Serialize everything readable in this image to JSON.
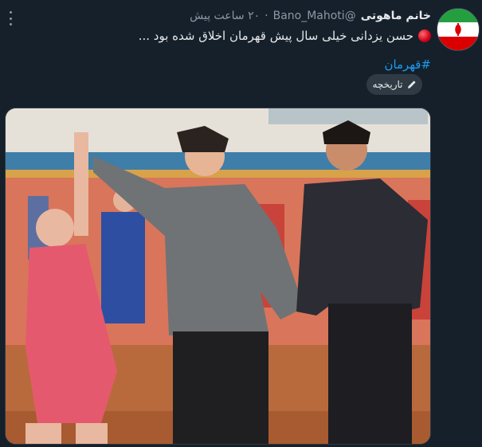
{
  "tweet": {
    "author_name": "خانم ماهوتی",
    "author_handle": "@Bano_Mahoti",
    "separator": "·",
    "timestamp": "۲۰ ساعت پیش",
    "text": "حسن یزدانی خیلی سال پیش قهرمان اخلاق شده بود ...",
    "hashtag": "#قهرمان",
    "history_label": "تاریخچه",
    "avatar_icon": "iran-emblem-avatar",
    "photo_icon": "wrestling-photo"
  },
  "colors": {
    "background": "#15202b",
    "text": "#e7e9ea",
    "muted": "#8b98a5",
    "link": "#1d9bf0",
    "button_bg": "#2f3a45",
    "red_emoji": "#d0021b"
  }
}
